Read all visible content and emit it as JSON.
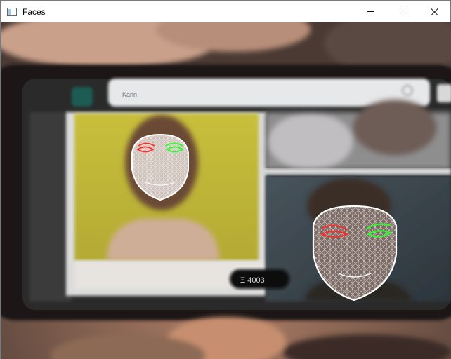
{
  "window": {
    "title": "Faces",
    "icon": "app-window-icon",
    "controls": [
      "minimize-icon",
      "maximize-icon",
      "close-icon"
    ]
  },
  "scene": {
    "search_query": "Karin",
    "pill_label": "Ξ 4003"
  },
  "colors": {
    "mesh": "#ffffff",
    "left_eye": "#ff2a2a",
    "right_eye": "#27ff27"
  }
}
